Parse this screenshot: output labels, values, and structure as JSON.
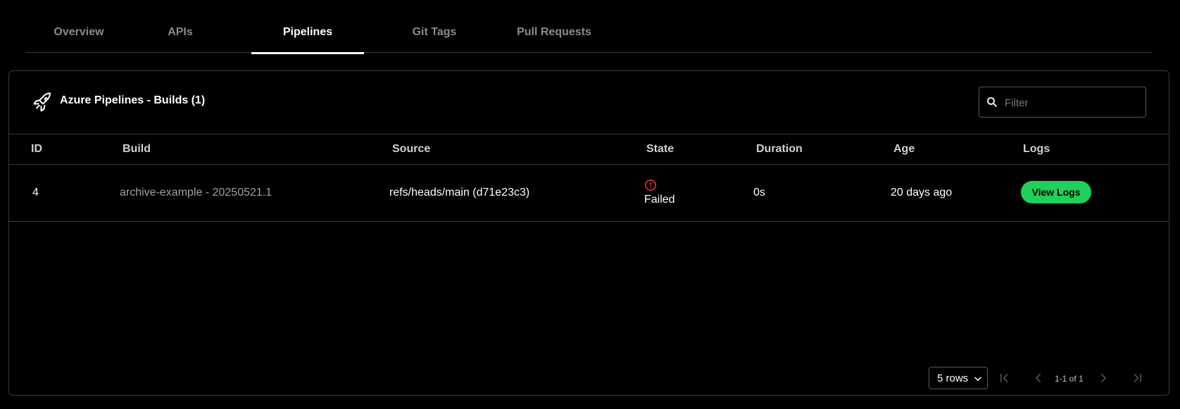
{
  "tabs": [
    {
      "label": "Overview"
    },
    {
      "label": "APIs"
    },
    {
      "label": "Pipelines"
    },
    {
      "label": "Git Tags"
    },
    {
      "label": "Pull Requests"
    }
  ],
  "active_tab": "Pipelines",
  "card": {
    "title": "Azure Pipelines - Builds (1)",
    "icon": "rocket-icon",
    "filter_placeholder": "Filter"
  },
  "table": {
    "headers": {
      "id": "ID",
      "build": "Build",
      "source": "Source",
      "state": "State",
      "duration": "Duration",
      "age": "Age",
      "logs": "Logs"
    },
    "rows": [
      {
        "id": "4",
        "build": "archive-example - 20250521.1",
        "source": "refs/heads/main (d71e23c3)",
        "state": "Failed",
        "duration": "0s",
        "age": "20 days ago",
        "logs_button": "View Logs"
      }
    ]
  },
  "pagination": {
    "rows_per_page": "5 rows",
    "range": "1-1 of 1"
  },
  "colors": {
    "accent_green": "#1fd05a",
    "error_red": "#e0323c",
    "background": "#000000",
    "border": "#3a3a3a"
  }
}
